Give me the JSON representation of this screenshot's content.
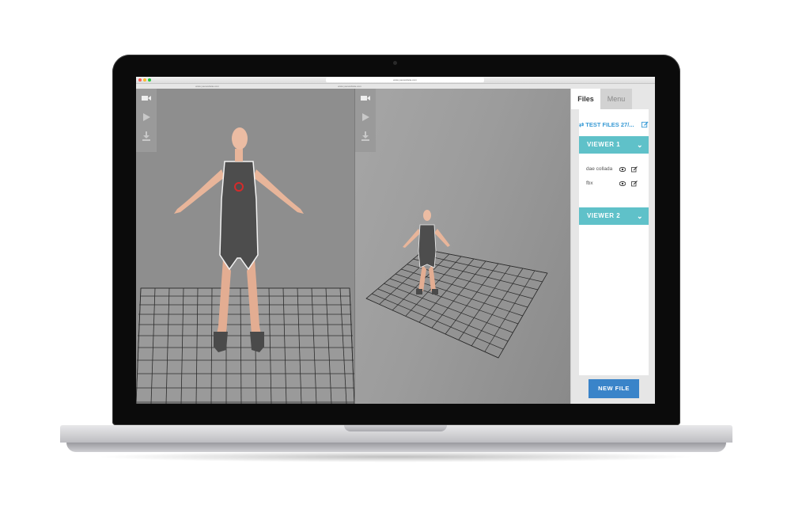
{
  "browser": {
    "address": "www.yourwebsite.com",
    "tabs": [
      "www.yourwebsite.com",
      "www.yourwebsite.com"
    ]
  },
  "toolbar": {
    "icons": [
      "video-camera-icon",
      "play-icon",
      "download-icon"
    ]
  },
  "panel": {
    "tabs": [
      {
        "label": "Files",
        "active": true
      },
      {
        "label": "Menu",
        "active": false
      }
    ],
    "files_title": "TEST FILES 27/...",
    "viewers": [
      {
        "label": "VIEWER 1",
        "expanded": true,
        "files": [
          {
            "name": "dae collada"
          },
          {
            "name": "fbx"
          }
        ]
      },
      {
        "label": "VIEWER 2",
        "expanded": false,
        "files": []
      }
    ],
    "new_file_label": "NEW FILE"
  },
  "colors": {
    "accent_teal": "#5fc1c9",
    "accent_blue": "#3a84c9",
    "link_blue": "#3a9bd5",
    "viewport_gray": "#8e8e8e"
  }
}
